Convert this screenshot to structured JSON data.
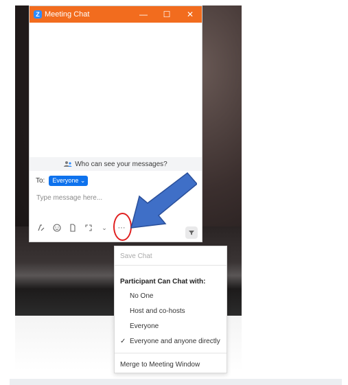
{
  "window": {
    "title": "Meeting Chat",
    "logo_letter": "Z",
    "minimize_label": "—",
    "maximize_label": "☐",
    "close_label": "✕"
  },
  "chat": {
    "visibility_notice": "Who can see your messages?",
    "to_label": "To:",
    "recipient": "Everyone",
    "recipient_caret": "⌄",
    "message_placeholder": "Type message here...",
    "more_label": "···"
  },
  "menu": {
    "save_chat": "Save Chat",
    "section_title": "Participant Can Chat with:",
    "options": [
      "No One",
      "Host and co-hosts",
      "Everyone",
      "Everyone and anyone directly"
    ],
    "checked_option": "Everyone and anyone directly",
    "check_mark": "✓",
    "merge": "Merge to Meeting Window"
  },
  "colors": {
    "titlebar": "#f26c1e",
    "accent": "#0e72ed",
    "annotation_circle": "#e02020",
    "annotation_arrow": "#3f6fc7"
  }
}
